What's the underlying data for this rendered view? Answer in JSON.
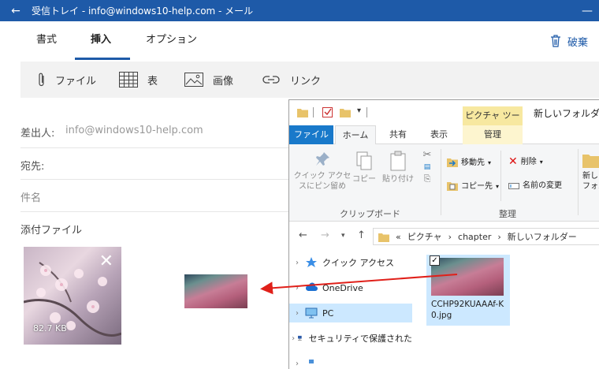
{
  "mail": {
    "title": "受信トレイ - info@windows10-help.com - メール",
    "tabs": [
      "書式",
      "挿入",
      "オプション"
    ],
    "discard_label": "破棄",
    "toolbar": {
      "file": "ファイル",
      "table": "表",
      "image": "画像",
      "link": "リンク"
    },
    "from_label": "差出人:",
    "from_value": "info@windows10-help.com",
    "to_label": "宛先:",
    "subject_label": "件名",
    "attachments_label": "添付ファイル",
    "attachment_size": "82.7 KB"
  },
  "explorer": {
    "picture_tools": "ピクチャ ツール",
    "window_title": "新しいフォルダー",
    "tabs": {
      "file": "ファイル",
      "home": "ホーム",
      "share": "共有",
      "view": "表示",
      "manage": "管理"
    },
    "ribbon": {
      "pin": "クイック アクセ\nスにピン留め",
      "copy": "コピー",
      "paste": "貼り付け",
      "clipboard_group": "クリップボード",
      "move_to": "移動先",
      "copy_to": "コピー先",
      "delete": "削除",
      "rename": "名前の変更",
      "new_folder": "新し\nフォル",
      "organize_group": "整理"
    },
    "address": [
      "«",
      "ピクチャ",
      "›",
      "chapter",
      "›",
      "新しいフォルダー"
    ],
    "nav": [
      "クイック アクセス",
      "OneDrive",
      "PC",
      "セキュリティで保護された"
    ],
    "file_name": "CCHP92KUAAAf-K0.jpg"
  }
}
